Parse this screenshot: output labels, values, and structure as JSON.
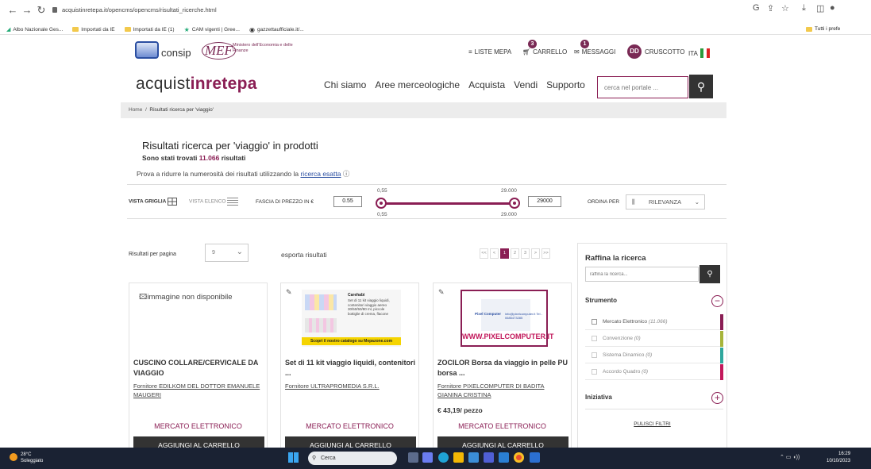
{
  "browser": {
    "url": "acquistinretepa.it/opencms/opencms/risultati_ricerche.html",
    "bookmarks": [
      "Albo Nazionale Ges...",
      "Importati da IE",
      "Importati da IE (1)",
      "CAM vigenti | Gree...",
      "gazzettaufficiale.it/..."
    ],
    "bookmarks_right": "Tutti i prefe"
  },
  "topbar": {
    "consip": "consip",
    "mef": "MEF",
    "mef_sub": "Ministero dell'Economia e delle Finanze",
    "liste_mepa": "LISTE MEPA",
    "carrello": "CARRELLO",
    "carrello_badge": "3",
    "messaggi": "MESSAGGI",
    "messaggi_badge": "1",
    "avatar": "DD",
    "cruscotto": "CRUSCOTTO",
    "lang": "ITA"
  },
  "header": {
    "logo_pre": "acquist",
    "logo_mid": "inrete",
    "logo_post": "pa",
    "nav": [
      "Chi siamo",
      "Aree merceologiche",
      "Acquista",
      "Vendi",
      "Supporto"
    ],
    "search_placeholder": "cerca nel portale ..."
  },
  "breadcrumb": {
    "home": "Home",
    "sep": "/",
    "current": "Risultati ricerca per 'viaggio'"
  },
  "results": {
    "title": "Risultati ricerca per 'viaggio' in prodotti",
    "count_pre": "Sono stati trovati ",
    "count": "11.066",
    "count_post": " risultati",
    "hint_pre": "Prova a ridurre la numerosità dei risultati utilizzando la ",
    "hint_link": "ricerca esatta"
  },
  "filters": {
    "grid_view": "VISTA GRIGLIA",
    "list_view": "VISTA ELENCO",
    "price_label": "FASCIA DI PREZZO IN €",
    "price_min": "0.55",
    "price_max": "29000",
    "slider_min_top": "0,55",
    "slider_max_top": "29.000",
    "slider_min_bottom": "0,55",
    "slider_max_bottom": "29.000",
    "sort_label": "ORDINA PER",
    "sort_value": "RILEVANZA"
  },
  "listing": {
    "per_page_label": "Risultati per pagina",
    "per_page_value": "9",
    "export": "esporta risultati",
    "pager": [
      "<<",
      "<",
      "1",
      "2",
      "3",
      ">",
      ">>"
    ]
  },
  "products": [
    {
      "image_text": "immagine non disponibile",
      "name": "CUSCINO COLLARE/CERVICALE DA VIAGGIO",
      "supplier": "Fornitore EDILKOM DEL DOTTOR EMANUELE MAUGERI",
      "price": "",
      "market": "MERCATO ELETTRONICO",
      "cta": "AGGIUNGI AL CARRELLO"
    },
    {
      "image_text": "Carehabi",
      "image_sub": "Set di 11 kit viaggio liquidi, contenitori viaggio aereo 30/50/50/80 ml, piccole bottiglie di crema, flacone",
      "image_banner": "Scopri il nostro catalogo su Mepazone.com",
      "name": "Set di 11 kit viaggio liquidi, contenitori ...",
      "supplier": "Fornitore ULTRAPROMEDIA S.R.L.",
      "price": "",
      "market": "MERCATO ELETTRONICO",
      "cta": "AGGIUNGI AL CARRELLO"
    },
    {
      "image_text": "WWW.PIXELCOMPUTER.IT",
      "image_sub": "Pixel Computer",
      "image_contact": "info@pixelcomputer.it Tel - 0685473285",
      "name": "ZOCILOR Borsa da viaggio in pelle PU borsa ...",
      "supplier": "Fornitore PIXELCOMPUTER DI BADITA GIANINA CRISTINA",
      "price": "€ 43,19/ pezzo",
      "market": "MERCATO ELETTRONICO",
      "cta": "AGGIUNGI AL CARRELLO"
    }
  ],
  "sidebar": {
    "title": "Raffina la ricerca",
    "input_placeholder": "raffina la ricerca...",
    "strumento": "Strumento",
    "options": [
      {
        "label": "Mercato Elettronico",
        "count": "(11.066)",
        "color": "#8a1e54"
      },
      {
        "label": "Convenzione",
        "count": "(0)",
        "color": "#a7b43a"
      },
      {
        "label": "Sistema Dinamico",
        "count": "(0)",
        "color": "#2fa79d"
      },
      {
        "label": "Accordo Quadro",
        "count": "(0)",
        "color": "#c2185b"
      }
    ],
    "iniziativa": "Iniziativa",
    "clear": "PULISCI FILTRI"
  },
  "taskbar": {
    "temp": "28°C",
    "weather": "Soleggiato",
    "search": "Cerca",
    "time": "16:29",
    "date": "10/10/2023"
  }
}
